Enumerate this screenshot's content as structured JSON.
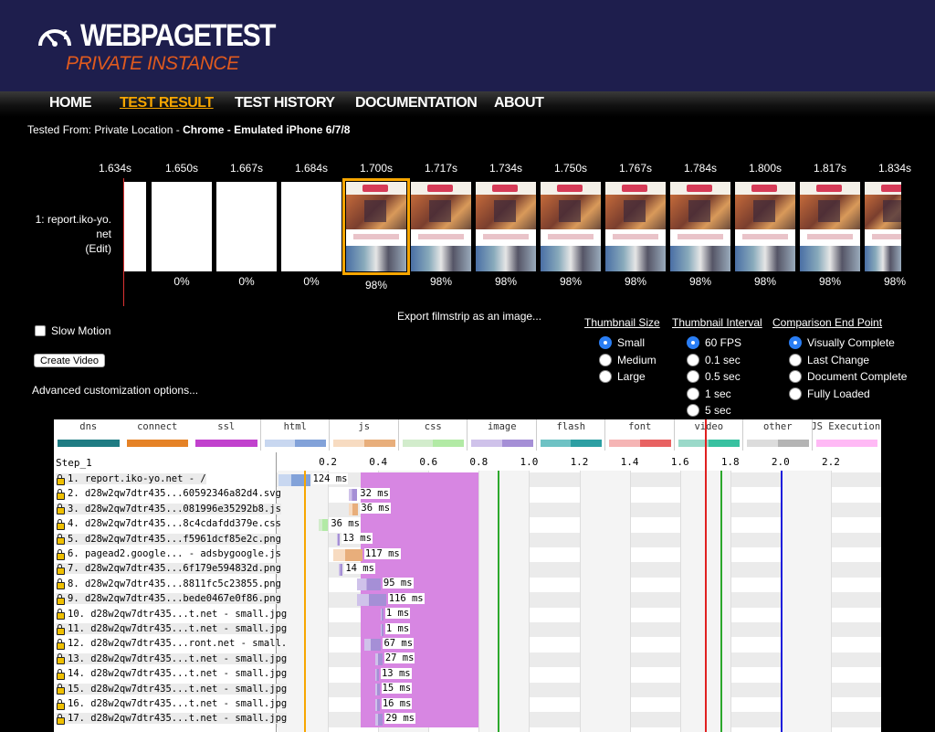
{
  "header": {
    "brand": "WEBPAGETEST",
    "sub": "PRIVATE INSTANCE",
    "nav": [
      {
        "label": "HOME",
        "active": false
      },
      {
        "label": "TEST RESULT",
        "active": true
      },
      {
        "label": "TEST HISTORY",
        "active": false
      },
      {
        "label": "DOCUMENTATION",
        "active": false
      },
      {
        "label": "ABOUT",
        "active": false
      }
    ]
  },
  "tested_from": {
    "prefix": "Tested From: Private Location - ",
    "device": "Chrome - Emulated iPhone 6/7/8"
  },
  "filmstrip": {
    "label_line1": "1: report.iko-yo.",
    "label_line2": "net",
    "label_line3": "(Edit)",
    "frames": [
      {
        "time": "1.634s",
        "pct": "",
        "shot": false,
        "partial": true
      },
      {
        "time": "1.650s",
        "pct": "0%",
        "shot": false
      },
      {
        "time": "1.667s",
        "pct": "0%",
        "shot": false
      },
      {
        "time": "1.684s",
        "pct": "0%",
        "shot": false
      },
      {
        "time": "1.700s",
        "pct": "98%",
        "shot": true,
        "highlight": true
      },
      {
        "time": "1.717s",
        "pct": "98%",
        "shot": true
      },
      {
        "time": "1.734s",
        "pct": "98%",
        "shot": true
      },
      {
        "time": "1.750s",
        "pct": "98%",
        "shot": true
      },
      {
        "time": "1.767s",
        "pct": "98%",
        "shot": true
      },
      {
        "time": "1.784s",
        "pct": "98%",
        "shot": true
      },
      {
        "time": "1.800s",
        "pct": "98%",
        "shot": true
      },
      {
        "time": "1.817s",
        "pct": "98%",
        "shot": true
      },
      {
        "time": "1.834s",
        "pct": "98%",
        "shot": true
      }
    ]
  },
  "controls": {
    "slow_motion": "Slow Motion",
    "create_video": "Create Video",
    "advanced": "Advanced customization options...",
    "export": "Export filmstrip as an image...",
    "thumb_size": {
      "title": "Thumbnail Size",
      "options": [
        {
          "label": "Small",
          "on": true
        },
        {
          "label": "Medium",
          "on": false
        },
        {
          "label": "Large",
          "on": false
        }
      ]
    },
    "thumb_interval": {
      "title": "Thumbnail Interval",
      "options": [
        {
          "label": "60 FPS",
          "on": true
        },
        {
          "label": "0.1 sec",
          "on": false
        },
        {
          "label": "0.5 sec",
          "on": false
        },
        {
          "label": "1 sec",
          "on": false
        },
        {
          "label": "5 sec",
          "on": false
        }
      ]
    },
    "end_point": {
      "title": "Comparison End Point",
      "options": [
        {
          "label": "Visually Complete",
          "on": true
        },
        {
          "label": "Last Change",
          "on": false
        },
        {
          "label": "Document Complete",
          "on": false
        },
        {
          "label": "Fully Loaded",
          "on": false
        }
      ]
    }
  },
  "waterfall": {
    "step": "Step_1",
    "legend": [
      {
        "label": "dns",
        "colors": [
          "#1f7c83"
        ]
      },
      {
        "label": "connect",
        "colors": [
          "#e58226"
        ]
      },
      {
        "label": "ssl",
        "colors": [
          "#c141cd"
        ]
      },
      {
        "label": "html",
        "colors": [
          "#c8d7f0",
          "#82a2d9"
        ]
      },
      {
        "label": "js",
        "colors": [
          "#f7dbc1",
          "#e8ae7b"
        ]
      },
      {
        "label": "css",
        "colors": [
          "#d2eccc",
          "#b2eaa5"
        ]
      },
      {
        "label": "image",
        "colors": [
          "#cfc2ea",
          "#a58fd6"
        ]
      },
      {
        "label": "flash",
        "colors": [
          "#6ec2c4",
          "#2d9fa3"
        ]
      },
      {
        "label": "font",
        "colors": [
          "#f5b4b4",
          "#e86262"
        ]
      },
      {
        "label": "video",
        "colors": [
          "#9ad9c9",
          "#38c1a0"
        ]
      },
      {
        "label": "other",
        "colors": [
          "#dcdcdc",
          "#b4b4b4"
        ]
      },
      {
        "label": "JS Execution",
        "colors": [
          "#ffb9f5"
        ]
      }
    ],
    "axis": {
      "min": 0.0,
      "max": 2.4,
      "ticks": [
        0.2,
        0.4,
        0.6,
        0.8,
        1.0,
        1.2,
        1.4,
        1.6,
        1.8,
        2.0,
        2.2
      ]
    },
    "markers": [
      {
        "name": "start-render",
        "t": 0.105,
        "color": "#f7a600"
      },
      {
        "name": "first-paint",
        "t": 0.875,
        "color": "#2ca82c"
      },
      {
        "name": "visually-complete",
        "t": 1.7,
        "color": "#e02020"
      },
      {
        "name": "dom-content-loaded",
        "t": 1.76,
        "color": "#2ca82c"
      },
      {
        "name": "on-load",
        "t": 2.0,
        "color": "#1e1edc"
      }
    ],
    "js_block": {
      "start": 0.33,
      "end": 0.8
    },
    "rows": [
      {
        "label": "1. report.iko-yo.net - /",
        "start": 0.005,
        "dur": 0.124,
        "ms": "124 ms",
        "type": "html"
      },
      {
        "label": "2. d28w2qw7dtr435...60592346a82d4.svg",
        "start": 0.285,
        "dur": 0.032,
        "ms": "32 ms",
        "type": "image"
      },
      {
        "label": "3. d28w2qw7dtr435...081996e35292b8.js",
        "start": 0.285,
        "dur": 0.036,
        "ms": "36 ms",
        "type": "js"
      },
      {
        "label": "4. d28w2qw7dtr435...8c4cdafdd379e.css",
        "start": 0.165,
        "dur": 0.036,
        "ms": "36 ms",
        "type": "css"
      },
      {
        "label": "5. d28w2qw7dtr435...f5961dcf85e2c.png",
        "start": 0.235,
        "dur": 0.013,
        "ms": "13 ms",
        "type": "image"
      },
      {
        "label": "6. pagead2.google... - adsbygoogle.js",
        "start": 0.22,
        "dur": 0.117,
        "ms": "117 ms",
        "type": "js"
      },
      {
        "label": "7. d28w2qw7dtr435...6f179e594832d.png",
        "start": 0.245,
        "dur": 0.014,
        "ms": "14 ms",
        "type": "image"
      },
      {
        "label": "8. d28w2qw7dtr435...8811fc5c23855.png",
        "start": 0.315,
        "dur": 0.095,
        "ms": "95 ms",
        "type": "image"
      },
      {
        "label": "9. d28w2qw7dtr435...bede0467e0f86.png",
        "start": 0.315,
        "dur": 0.116,
        "ms": "116 ms",
        "type": "image"
      },
      {
        "label": "10. d28w2qw7dtr435...t.net - small.jpg",
        "start": 0.41,
        "dur": 0.001,
        "ms": "1 ms",
        "type": "image"
      },
      {
        "label": "11. d28w2qw7dtr435...t.net - small.jpg",
        "start": 0.41,
        "dur": 0.001,
        "ms": "1 ms",
        "type": "image"
      },
      {
        "label": "12. d28w2qw7dtr435...ront.net - small.",
        "start": 0.345,
        "dur": 0.067,
        "ms": "67 ms",
        "type": "image"
      },
      {
        "label": "13. d28w2qw7dtr435...t.net - small.jpg",
        "start": 0.39,
        "dur": 0.027,
        "ms": "27 ms",
        "type": "image"
      },
      {
        "label": "14. d28w2qw7dtr435...t.net - small.jpg",
        "start": 0.39,
        "dur": 0.013,
        "ms": "13 ms",
        "type": "image"
      },
      {
        "label": "15. d28w2qw7dtr435...t.net - small.jpg",
        "start": 0.39,
        "dur": 0.015,
        "ms": "15 ms",
        "type": "image"
      },
      {
        "label": "16. d28w2qw7dtr435...t.net - small.jpg",
        "start": 0.39,
        "dur": 0.016,
        "ms": "16 ms",
        "type": "image"
      },
      {
        "label": "17. d28w2qw7dtr435...t.net - small.jpg",
        "start": 0.39,
        "dur": 0.029,
        "ms": "29 ms",
        "type": "image"
      }
    ]
  }
}
